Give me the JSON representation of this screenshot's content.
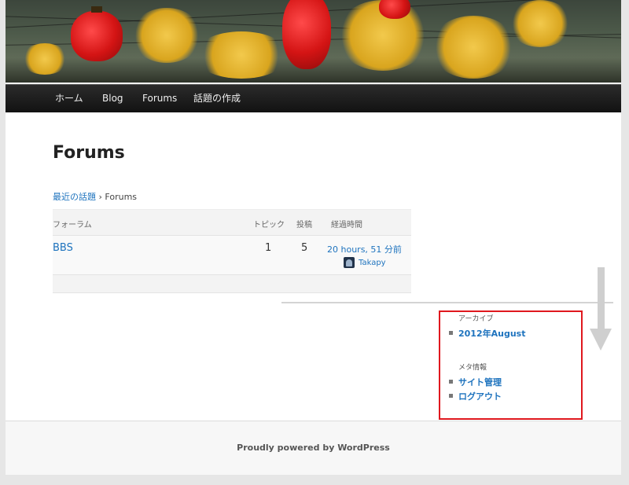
{
  "nav": {
    "items": [
      {
        "label": "ホーム"
      },
      {
        "label": "Blog"
      },
      {
        "label": "Forums"
      },
      {
        "label": "話題の作成"
      }
    ]
  },
  "main": {
    "title": "Forums",
    "breadcrumb": {
      "link": "最近の話題",
      "separator": "›",
      "current": "Forums"
    },
    "table": {
      "headers": {
        "forum": "フォーラム",
        "topics": "トピック",
        "posts": "投稿",
        "freshness": "経過時間"
      },
      "rows": [
        {
          "forum": "BBS",
          "topics": "1",
          "posts": "5",
          "freshness": "20 hours, 51 分前",
          "author": "Takapy"
        }
      ]
    }
  },
  "sidebar": {
    "archive_title": "アーカイブ",
    "archive_items": [
      "2012年August"
    ],
    "meta_title": "メタ情報",
    "meta_items": [
      "サイト管理",
      "ログアウト"
    ]
  },
  "footer": {
    "text": "Proudly powered by WordPress"
  },
  "colors": {
    "link": "#1e73be",
    "highlight_border": "#e0181e",
    "navbar": "#1b1b1b"
  }
}
